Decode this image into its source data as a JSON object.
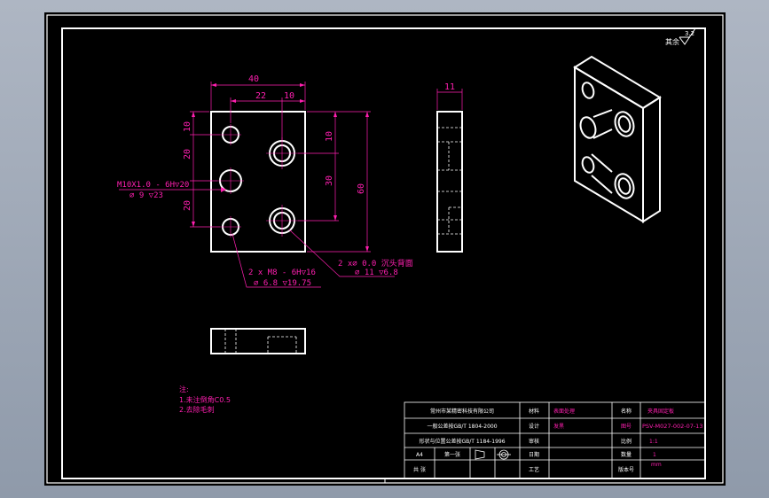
{
  "dimensions": {
    "width_40": "40",
    "width_22": "22",
    "width_10": "10",
    "left_10": "10",
    "left_20": "20",
    "left_20b": "20",
    "right_10": "10",
    "right_30": "30",
    "height_60": "60",
    "side_11": "11"
  },
  "callouts": {
    "m10_line1": "M10X1.0 - 6H▽20",
    "m10_line2": "⌀ 9 ▽23",
    "m8_line1": "2 x  M8 - 6H▽16",
    "m8_line2": "⌀ 6.8 ▽19.75",
    "cb_line1": "2 x⌀  0.0 沉头背面",
    "cb_line2": "⌀ 11 ▽6.8"
  },
  "roughness": {
    "label": "其余",
    "value": "3.2"
  },
  "notes": {
    "heading": "注:",
    "line1": "1.未注倒角C0.5",
    "line2": "2.去除毛刺"
  },
  "title_block": {
    "company": "常州市某精密科技有限公司",
    "row2": "一般公差按GB/T 1804-2000",
    "row3": "形状与位置公差按GB/T 1184-1996",
    "label_material": "材料",
    "value_material_a": "表面处理",
    "value_material_b": "发黑",
    "label_name": "名称",
    "value_name": "夹具固定板",
    "label_drawing_no": "图号",
    "value_drawing_no": "PSV-M027-002-07-13",
    "label_qty": "数量",
    "value_qty": "1",
    "label_design": "设计",
    "label_check": "审核",
    "label_scale": "比例",
    "value_scale": "1:1",
    "label_process": "工艺",
    "label_sheet": "第一张",
    "label_total": "共  张",
    "value_unit": "mm",
    "value_a4": "A4",
    "label_version": "版本号",
    "label_date": "日期"
  }
}
